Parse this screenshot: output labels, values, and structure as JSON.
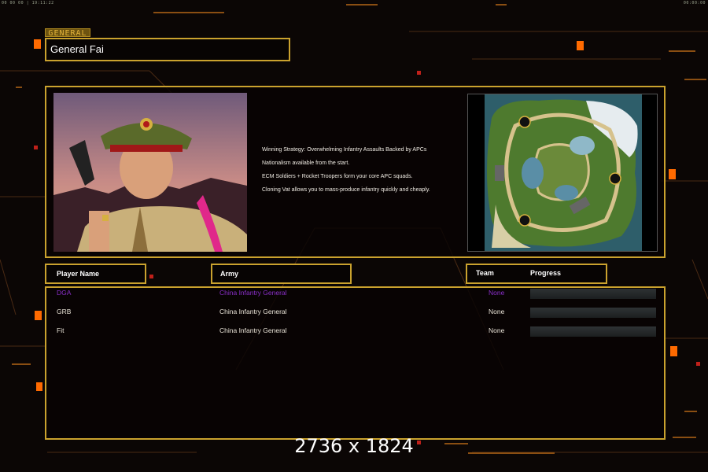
{
  "hud": {
    "left": "00 00 00 | 19:11:22",
    "right": "00:00:00"
  },
  "general": {
    "tag": "GENERAL",
    "name": "General Fai"
  },
  "description": {
    "lines": [
      "Winning Strategy: Overwhelming Infantry Assaults Backed by APCs",
      "Nationalism available from the start.",
      "ECM Soldiers + Rocket Troopers form your core APC squads.",
      "Cloning Vat allows you to mass-produce infantry quickly and cheaply."
    ]
  },
  "table": {
    "headers": {
      "player": "Player Name",
      "army": "Army",
      "team": "Team",
      "progress": "Progress"
    },
    "rows": [
      {
        "player": "DGA",
        "army": "China Infantry General",
        "team": "None",
        "color": "#8a2fc9",
        "progress": 0
      },
      {
        "player": "GRB",
        "army": "China Infantry General",
        "team": "None",
        "color": "#e8e2d6",
        "progress": 0
      },
      {
        "player": "Fit",
        "army": "China Infantry General",
        "team": "None",
        "color": "#e8e2d6",
        "progress": 0
      }
    ]
  },
  "watermark": "2736 x 1824",
  "colors": {
    "accent": "#caa22e",
    "hudOrange": "#ff6a00"
  }
}
